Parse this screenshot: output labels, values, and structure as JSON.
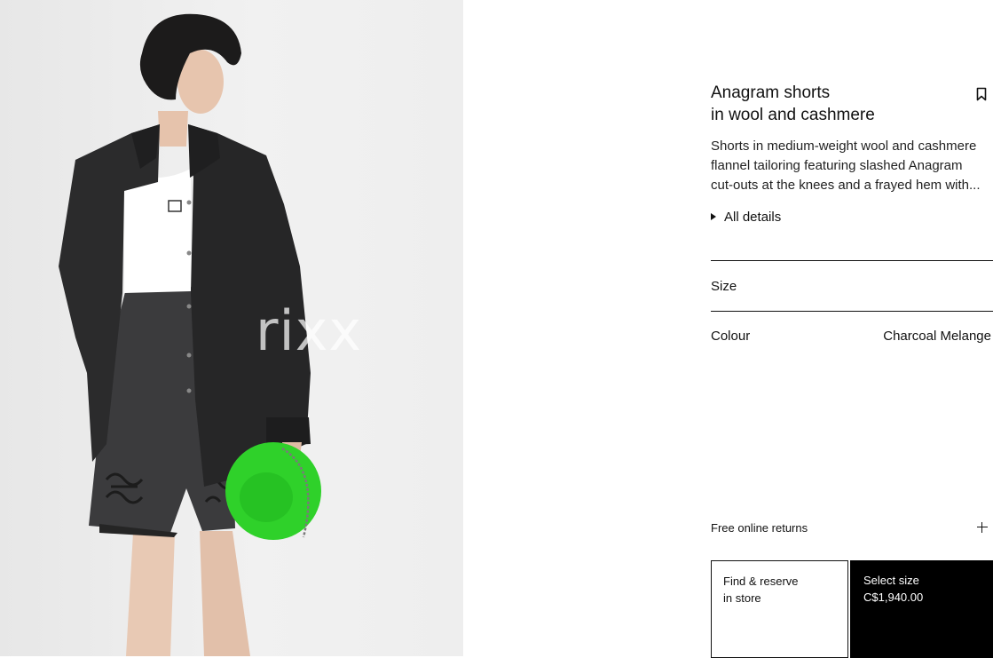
{
  "product": {
    "title_line1": "Anagram shorts",
    "title_line2": "in wool and cashmere",
    "description_lines": [
      "Shorts in medium-weight wool and cashmere",
      "flannel tailoring featuring slashed Anagram",
      "cut-outs at the knees and a frayed hem with..."
    ],
    "all_details_label": "All details"
  },
  "selectors": {
    "size_label": "Size",
    "colour_label": "Colour",
    "colour_value": "Charcoal Melange"
  },
  "returns_label": "Free online returns",
  "actions": {
    "store_line1": "Find & reserve",
    "store_line2": "in store",
    "select_label": "Select size",
    "price": "C$1,940.00"
  },
  "image": {
    "watermark": "rixx"
  },
  "colors": {
    "accent": "#000000",
    "bag_green": "#2fd12a",
    "jacket": "#2a2a2a"
  },
  "icons": {
    "bookmark": "bookmark-icon",
    "expand": "triangle-right-icon",
    "returns_toggle": "plus-icon"
  }
}
